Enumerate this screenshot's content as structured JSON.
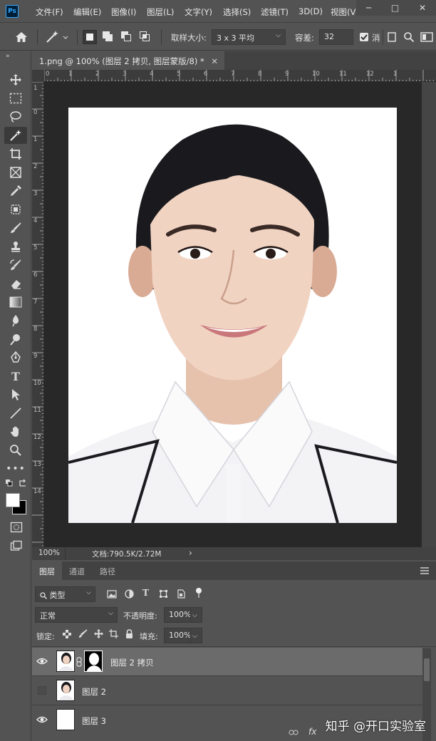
{
  "app": {
    "logo_text": "Ps"
  },
  "menu": {
    "items": [
      "文件(F)",
      "编辑(E)",
      "图像(I)",
      "图层(L)",
      "文字(Y)",
      "选择(S)",
      "滤镜(T)",
      "3D(D)",
      "视图(V"
    ]
  },
  "window_controls": {
    "minimize": "─",
    "maximize": "□",
    "close": "✕"
  },
  "options": {
    "sample_size_label": "取样大小:",
    "sample_size_value": "3 x 3 平均",
    "tolerance_label": "容差:",
    "tolerance_value": "32",
    "anti_alias_label": "消"
  },
  "document": {
    "tab_title": "1.png @ 100% (图层 2 拷贝, 图层蒙版/8) *",
    "tab_close": "✕",
    "ruler_h_labels": [
      "0",
      "1",
      "2",
      "3",
      "4",
      "5",
      "6",
      "7",
      "8",
      "9",
      "10",
      "11",
      "12",
      "1"
    ],
    "ruler_v_labels": [
      "1",
      "0",
      "1",
      "2",
      "3",
      "4",
      "5",
      "6",
      "7",
      "8",
      "9",
      "10",
      "11",
      "12",
      "13",
      "14"
    ]
  },
  "status": {
    "zoom": "100%",
    "doc_info": "文档:790.5K/2.72M",
    "arrow": "›"
  },
  "layers_panel": {
    "tabs": [
      "图层",
      "通道",
      "路径"
    ],
    "filter_label": "类型",
    "blend_mode": "正常",
    "opacity_label": "不透明度:",
    "opacity_value": "100%",
    "lock_label": "锁定:",
    "fill_label": "填充:",
    "fill_value": "100%",
    "layers": [
      {
        "name": "图层 2 拷贝",
        "visible": true,
        "selected": true,
        "has_mask": true
      },
      {
        "name": "图层 2",
        "visible": false,
        "selected": false,
        "has_mask": false
      },
      {
        "name": "图层 3",
        "visible": true,
        "selected": false,
        "has_mask": false
      }
    ],
    "footer_fx": "fx"
  },
  "watermark": "知乎 @开口实验室",
  "colors": {
    "ui_bg": "#535353",
    "canvas_bg": "#282828",
    "accent": "#31a8ff"
  }
}
